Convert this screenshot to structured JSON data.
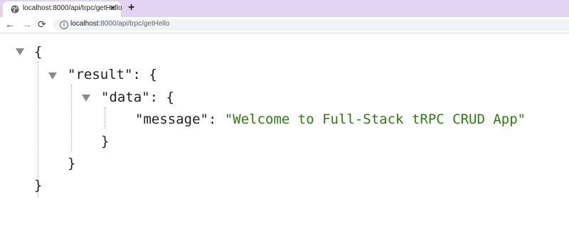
{
  "browser": {
    "tab": {
      "title": "localhost:8000/api/trpc/getHello",
      "close_glyph": "✕",
      "icon": "globe-icon"
    },
    "new_tab_glyph": "+",
    "nav": {
      "back": "←",
      "forward": "→",
      "reload": "⟳"
    },
    "address": {
      "host": "localhost",
      "rest": ":8000/api/trpc/getHello",
      "info_glyph": "i"
    }
  },
  "json_view": {
    "open_brace": "{",
    "close_brace": "}",
    "result_key": "\"result\"",
    "data_key": "\"data\"",
    "message_key": "\"message\"",
    "colon_brace": ": {",
    "colon": ": ",
    "message_value": "\"Welcome to Full-Stack tRPC CRUD App\""
  },
  "colors": {
    "tab_strip": "#e3d3f3",
    "string_value": "#2f7c12"
  }
}
